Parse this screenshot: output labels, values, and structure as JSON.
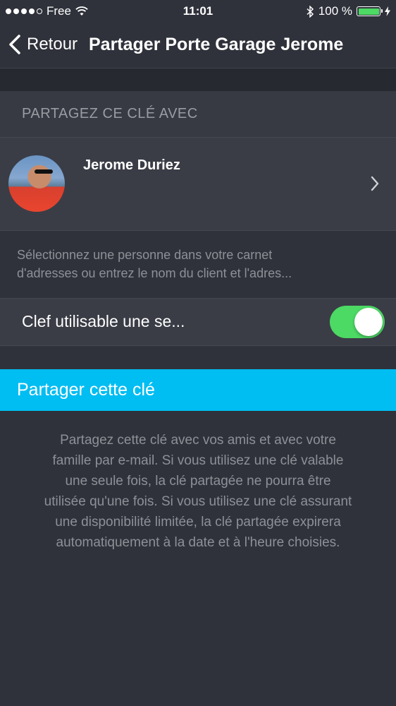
{
  "status_bar": {
    "carrier": "Free",
    "time": "11:01",
    "battery": "100 %",
    "signal_dots_filled": 4,
    "signal_dots_total": 5,
    "icons": [
      "wifi-icon",
      "bluetooth-icon",
      "battery-icon",
      "charging-icon"
    ]
  },
  "nav": {
    "back_label": "Retour",
    "title": "Partager Porte Garage Jerome"
  },
  "share_section": {
    "header": "PARTAGEZ CE CLÉ AVEC",
    "contact_name": "Jerome Duriez",
    "helper_line1": "Sélectionnez une personne dans votre carnet",
    "helper_line2": "d'adresses ou entrez le nom du client et l'adres..."
  },
  "single_use": {
    "label": "Clef utilisable une se...",
    "enabled": true
  },
  "share_button": {
    "label": "Partager cette clé"
  },
  "description": {
    "lines": [
      "Partagez cette clé avec vos amis et avec votre",
      "famille par e-mail. Si vous utilisez une clé valable",
      "une seule fois, la clé partagée ne pourra être",
      "utilisée qu'une fois. Si vous utilisez une clé assurant",
      "une disponibilité limitée, la clé partagée  expirera",
      "automatiquement à la date et à l'heure choisies."
    ]
  },
  "colors": {
    "background": "#2f323b",
    "accent": "#00bdf2",
    "switch_on": "#4cd964",
    "muted_text": "#8e9097"
  }
}
